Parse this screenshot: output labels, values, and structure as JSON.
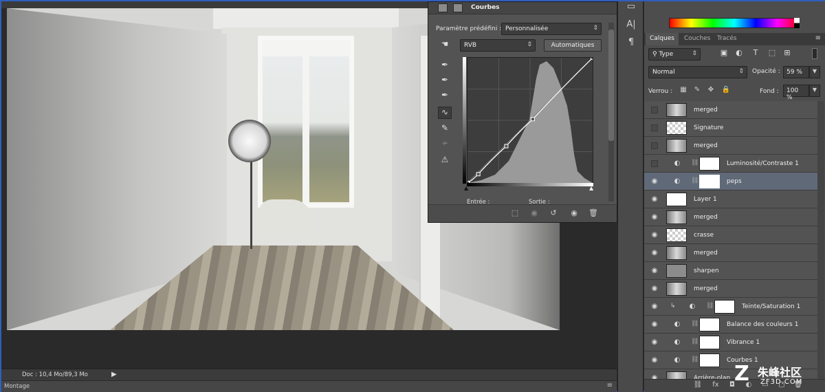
{
  "status": {
    "doc_info": "Doc : 10,4 Mo/89,3 Mo",
    "montage": "Montage"
  },
  "curves": {
    "title": "Courbes",
    "preset_label": "Paramètre prédéfini :",
    "preset_value": "Personnalisée",
    "channel": "RVB",
    "auto_label": "Automatiques",
    "input_label": "Entrée :",
    "output_label": "Sortie :",
    "points": [
      [
        0,
        0
      ],
      [
        22,
        18
      ],
      [
        79,
        75
      ],
      [
        133,
        130
      ],
      [
        255,
        255
      ]
    ]
  },
  "tool_strip": {
    "char_icon": "A|",
    "para_icon": "¶"
  },
  "layers_panel": {
    "tabs": [
      "Calques",
      "Couches",
      "Tracés"
    ],
    "filter_type": "Type",
    "blend_mode": "Normal",
    "opacity_label": "Opacité :",
    "opacity_value": "59 %",
    "lock_label": "Verrou :",
    "fill_label": "Fond :",
    "fill_value": "100 %",
    "layers": [
      {
        "name": "merged",
        "visible": false,
        "thumb": "photo",
        "adjustment": false,
        "clipped": false,
        "selected": false
      },
      {
        "name": "Signature",
        "visible": false,
        "thumb": "check",
        "adjustment": false,
        "clipped": false,
        "selected": false
      },
      {
        "name": "merged",
        "visible": false,
        "thumb": "photo",
        "adjustment": false,
        "clipped": false,
        "selected": false
      },
      {
        "name": "Luminosité/Contraste 1",
        "visible": false,
        "thumb": "white",
        "adjustment": true,
        "clipped": false,
        "selected": false
      },
      {
        "name": "peps",
        "visible": true,
        "thumb": "white",
        "adjustment": true,
        "clipped": false,
        "selected": true
      },
      {
        "name": "Layer 1",
        "visible": true,
        "thumb": "white",
        "adjustment": false,
        "clipped": false,
        "selected": false
      },
      {
        "name": "merged",
        "visible": true,
        "thumb": "photo",
        "adjustment": false,
        "clipped": false,
        "selected": false
      },
      {
        "name": "crasse",
        "visible": true,
        "thumb": "check",
        "adjustment": false,
        "clipped": false,
        "selected": false
      },
      {
        "name": "merged",
        "visible": true,
        "thumb": "photo",
        "adjustment": false,
        "clipped": false,
        "selected": false
      },
      {
        "name": "sharpen",
        "visible": true,
        "thumb": "gray",
        "adjustment": false,
        "clipped": false,
        "selected": false
      },
      {
        "name": "merged",
        "visible": true,
        "thumb": "photo",
        "adjustment": false,
        "clipped": false,
        "selected": false
      },
      {
        "name": "Teinte/Saturation 1",
        "visible": true,
        "thumb": "white",
        "adjustment": true,
        "clipped": true,
        "selected": false
      },
      {
        "name": "Balance des couleurs 1",
        "visible": true,
        "thumb": "white",
        "adjustment": true,
        "clipped": false,
        "selected": false
      },
      {
        "name": "Vibrance 1",
        "visible": true,
        "thumb": "white",
        "adjustment": true,
        "clipped": false,
        "selected": false
      },
      {
        "name": "Courbes 1",
        "visible": true,
        "thumb": "white",
        "adjustment": true,
        "clipped": false,
        "selected": false
      },
      {
        "name": "Arrière-plan",
        "visible": true,
        "thumb": "photo",
        "adjustment": false,
        "clipped": false,
        "selected": false
      }
    ]
  },
  "watermark": {
    "mark": "Z",
    "cn": "朱峰社区",
    "url": "ZF3D.COM"
  },
  "colors": {
    "selected_layer": "#5f6978",
    "panel_bg": "#535353",
    "window_border": "#2f5fbf"
  }
}
